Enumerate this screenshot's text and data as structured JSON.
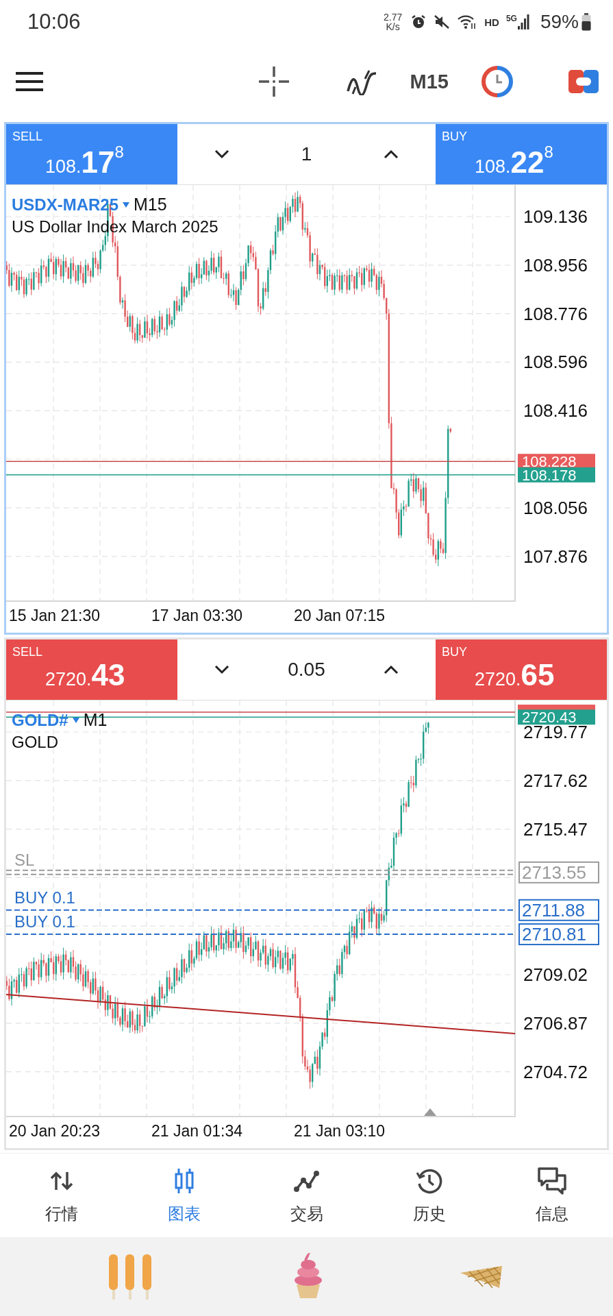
{
  "status_bar": {
    "time": "10:06",
    "network_speed": {
      "value": "2.77",
      "unit": "K/s"
    },
    "hd": "HD",
    "network_type": "5G",
    "battery": "59%"
  },
  "toolbar": {
    "timeframe": "M15"
  },
  "charts": [
    {
      "selected": true,
      "color": "#3a88f5",
      "sell": {
        "label": "SELL",
        "price_main": "108.",
        "price_big": "17",
        "price_sup": "8"
      },
      "lot": "1",
      "buy": {
        "label": "BUY",
        "price_main": "108.",
        "price_big": "22",
        "price_sup": "8"
      },
      "symbol": "USDX-MAR25",
      "timeframe": "M15",
      "description": "US Dollar Index March 2025",
      "axis_labels": [
        "109.136",
        "108.956",
        "108.776",
        "108.596",
        "108.416",
        "108.056",
        "107.876"
      ],
      "price_lines": [
        {
          "kind": "ask",
          "label": "108.228"
        },
        {
          "kind": "bid",
          "label": "108.178"
        }
      ],
      "trend_line": false,
      "shift_marker": false,
      "time_labels": [
        "15 Jan 21:30",
        "17 Jan 03:30",
        "20 Jan 07:15"
      ]
    },
    {
      "selected": false,
      "color": "#e84c4c",
      "sell": {
        "label": "SELL",
        "price_main": "2720.",
        "price_big": "43"
      },
      "lot": "0.05",
      "buy": {
        "label": "BUY",
        "price_main": "2720.",
        "price_big": "65"
      },
      "symbol": "GOLD#",
      "timeframe": "M1",
      "description": "GOLD",
      "axis_labels": [
        "2719.77",
        "2717.62",
        "2715.47",
        "2709.02",
        "2706.87",
        "2704.72"
      ],
      "price_lines": [
        {
          "kind": "ask"
        },
        {
          "kind": "bid",
          "label": "2720.43"
        }
      ],
      "levels": [
        {
          "kind": "sl",
          "label": "SL",
          "tag": "2713.55"
        },
        {
          "kind": "buy",
          "label": "BUY 0.1",
          "tag": "2711.88"
        },
        {
          "kind": "buy",
          "label": "BUY 0.1",
          "tag": "2710.81"
        }
      ],
      "trend_line": true,
      "shift_marker": true,
      "time_labels": [
        "20 Jan 20:23",
        "21 Jan 01:34",
        "21 Jan 03:10"
      ]
    }
  ],
  "nav": [
    {
      "label": "行情",
      "selected": false
    },
    {
      "label": "图表",
      "selected": true
    },
    {
      "label": "交易",
      "selected": false
    },
    {
      "label": "历史",
      "selected": false
    },
    {
      "label": "信息",
      "selected": false
    }
  ]
}
